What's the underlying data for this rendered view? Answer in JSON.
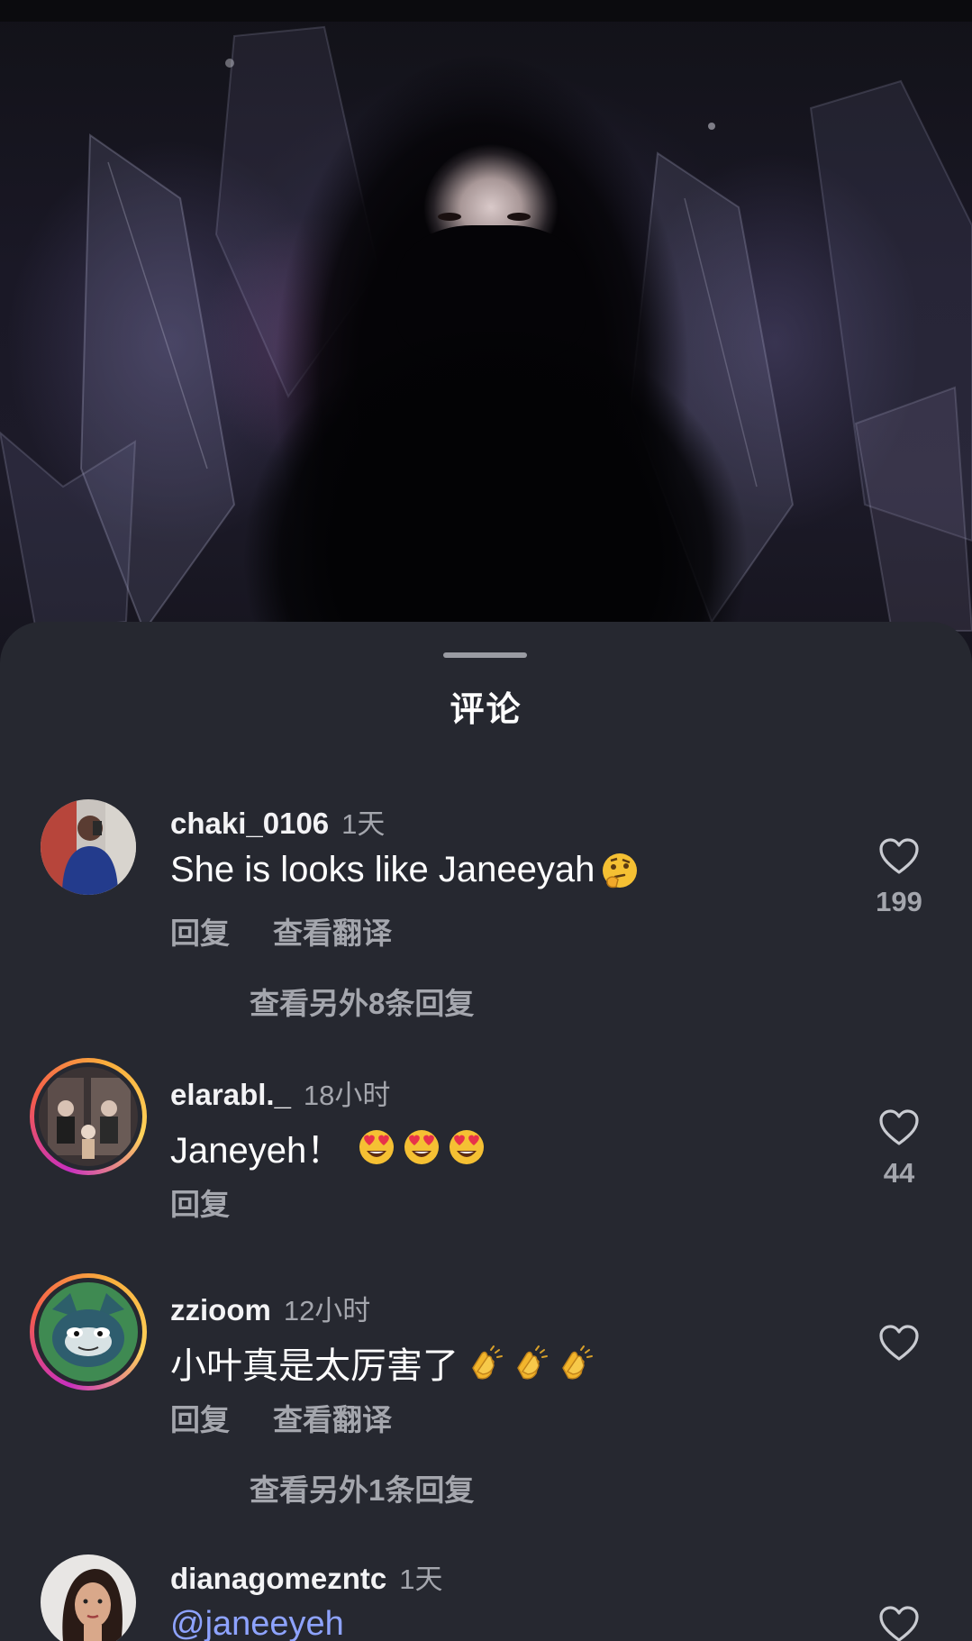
{
  "sheet": {
    "title": "评论"
  },
  "comments": [
    {
      "username": "chaki_0106",
      "time": "1天",
      "text": "She is looks like Janeeyah",
      "emojis": [
        "thinking-face"
      ],
      "reply_label": "回复",
      "translate_label": "查看翻译",
      "more_replies": "查看另外8条回复",
      "likes": "199"
    },
    {
      "username": "elarabl._",
      "time": "18小时",
      "text": "Janeyeh！",
      "emojis": [
        "heart-eyes",
        "heart-eyes",
        "heart-eyes"
      ],
      "reply_label": "回复",
      "likes": "44"
    },
    {
      "username": "zzioom",
      "time": "12小时",
      "text": "小叶真是太厉害了",
      "emojis": [
        "clapping-hands",
        "clapping-hands",
        "clapping-hands"
      ],
      "reply_label": "回复",
      "translate_label": "查看翻译",
      "more_replies": "查看另外1条回复"
    },
    {
      "username": "dianagomezntc",
      "time": "1天",
      "text": "@janeeyeh"
    }
  ],
  "colors": {
    "sheet_bg": "#262830",
    "primary_text": "#ffffff",
    "secondary_text": "#a4a6ad",
    "mention": "#8ea3ff",
    "story_ring": [
      "#c82fbf",
      "#f55d4a",
      "#f9ae3c"
    ]
  },
  "icons": [
    "heart-outline-icon",
    "thinking-face-emoji",
    "heart-eyes-emoji",
    "clapping-hands-emoji"
  ]
}
